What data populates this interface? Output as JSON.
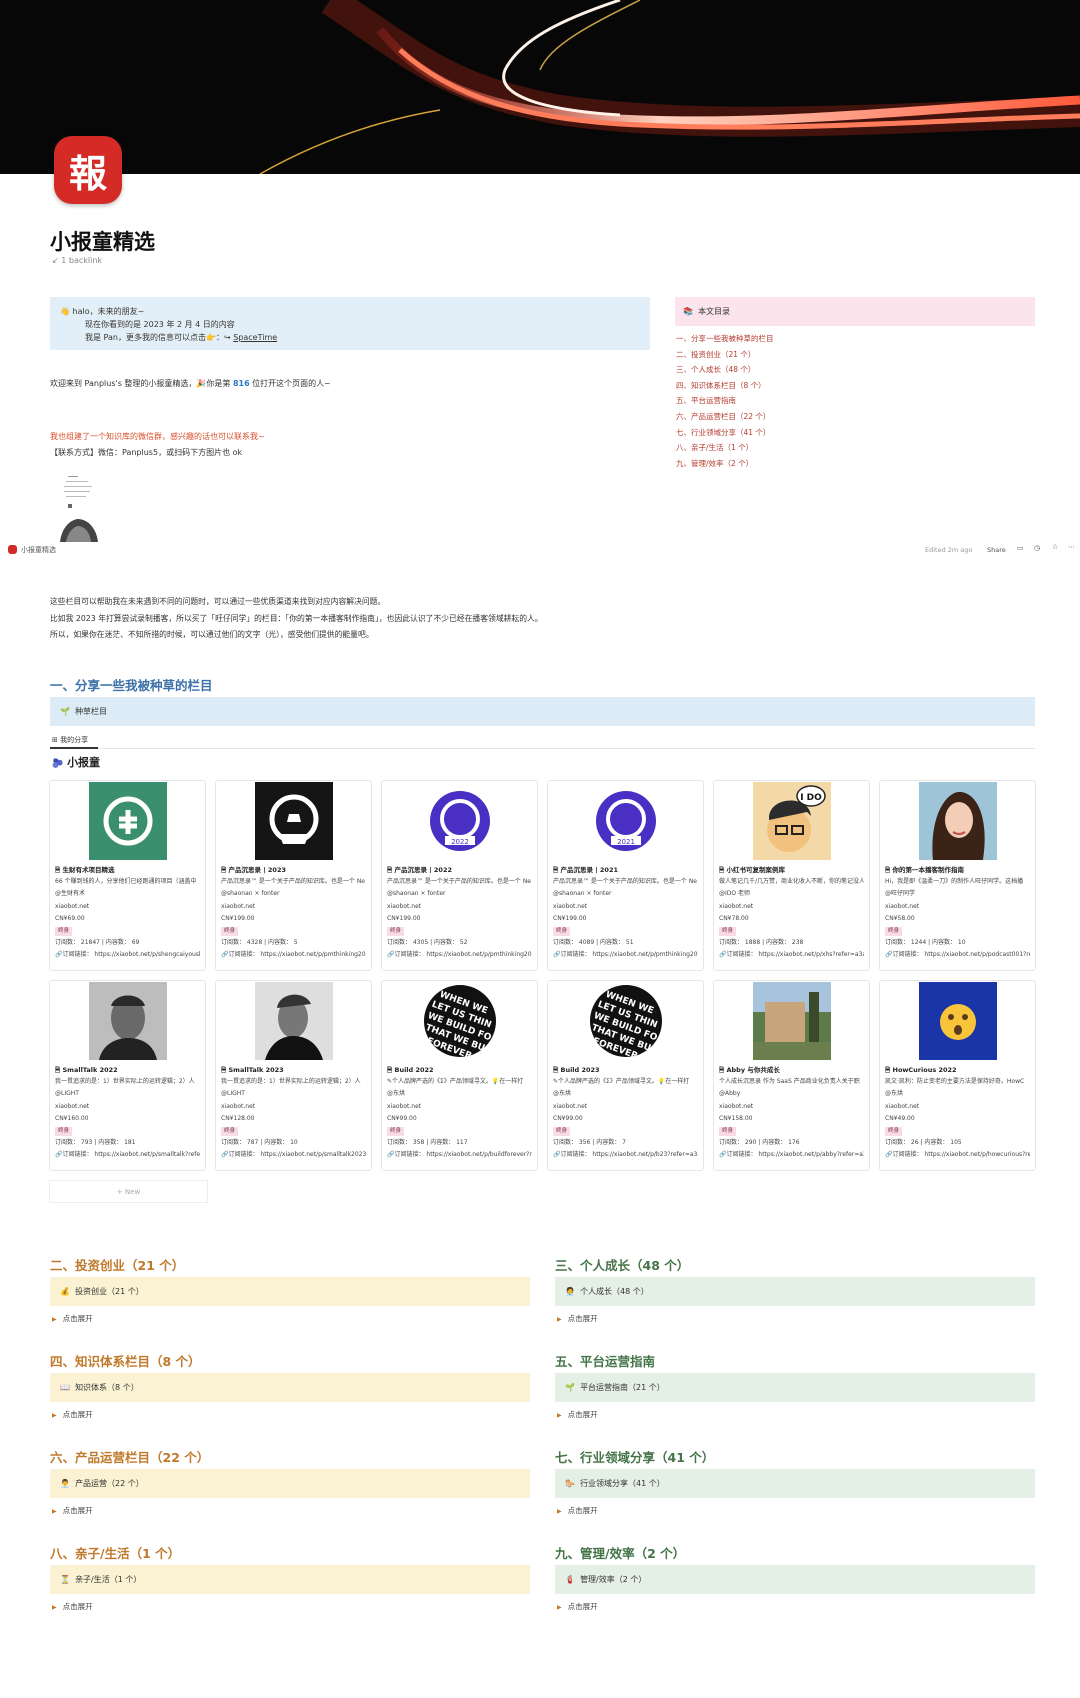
{
  "page": {
    "icon_char": "報",
    "title": "小报童精选",
    "backlink": "↙ 1 backlink"
  },
  "callout": {
    "line1": "halo，未来的朋友~",
    "line2": "现在你看到的是 2023 年 2 月 4 日的内容",
    "line3": "我是 Pan，更多我的信息可以点击",
    "link": "SpaceTime"
  },
  "toc": {
    "title": "本文目录",
    "items": [
      "一、分享一些我被种草的栏目",
      "二、投资创业（21 个）",
      "三、个人成长（48 个）",
      "四、知识体系栏目（8 个）",
      "五、平台运营指南",
      "六、产品运营栏目（22 个）",
      "七、行业领域分享（41 个）",
      "八、亲子/生活（1 个）",
      "九、管理/效率（2 个）"
    ]
  },
  "welcome": {
    "pre": "欢迎来到 Panplus's 整理的小报童精选，🎉你是第 ",
    "count": "816",
    "post": " 位打开这个页面的人~"
  },
  "wechat": {
    "line1": "我也组建了一个知识库的微信群，感兴趣的话也可以联系我~",
    "line2": "【联系方式】微信：Panplus5，或扫码下方图片也 ok"
  },
  "topbar": {
    "breadcrumb": "小报童精选",
    "edited": "Edited 2m ago",
    "share": "Share"
  },
  "intro": [
    "这些栏目可以帮助我在未来遇到不同的问题时，可以通过一些优质渠道来找到对应内容解决问题。",
    "比如我 2023 年打算尝试录制播客，所以买了「旺仔同学」的栏目：「你的第一本播客制作指南」，也因此认识了不少已经在播客领域耕耘的人。",
    "所以，如果你在迷茫、不知所措的时候，可以通过他们的文字（光），感受他们提供的能量吧。"
  ],
  "section1": {
    "heading": "一、分享一些我被种草的栏目",
    "bar": "种草栏目",
    "tab": "我的分享",
    "sub": "小报童"
  },
  "cards": [
    {
      "title": "生财有术项目精选",
      "desc": "66 个赚到钱的人，分享他们已经跑通的项目（涵盖中",
      "author": "@生财有术",
      "site": "xiaobot.net",
      "price": "CN¥69.00",
      "tag": "终身",
      "stats": "订阅数： 21847 | 内容数： 69",
      "link": "订阅链接： https://xiaobot.net/p/shengcaiyoush",
      "bg": "#3a8f6e",
      "icon": "sc"
    },
    {
      "title": "产品沉思录 | 2023",
      "desc": "产品沉思录™ 是一个关于产品的知识库。也是一个 Ne",
      "author": "@shaonan × fonter",
      "site": "xiaobot.net",
      "price": "CN¥199.00",
      "tag": "终身",
      "stats": "订阅数： 4328 | 内容数： 5",
      "link": "订阅链接： https://xiaobot.net/p/pmthinking202",
      "bg": "#151515",
      "icon": "pm"
    },
    {
      "title": "产品沉思录 | 2022",
      "desc": "产品沉思录™ 是一个关于产品的知识库。也是一个 Ne",
      "author": "@shaonan × fonter",
      "site": "xiaobot.net",
      "price": "CN¥199.00",
      "tag": "终身",
      "stats": "订阅数： 4305 | 内容数： 52",
      "link": "订阅链接： https://xiaobot.net/p/pmthinking202",
      "bg": "#fff",
      "icon": "p22"
    },
    {
      "title": "产品沉思录 | 2021",
      "desc": "产品沉思录™ 是一个关于产品的知识库。也是一个 Ne",
      "author": "@shaonan × fonter",
      "site": "xiaobot.net",
      "price": "CN¥199.00",
      "tag": "终身",
      "stats": "订阅数： 4089 | 内容数： 51",
      "link": "订阅链接： https://xiaobot.net/p/pmthinking202",
      "bg": "#fff",
      "icon": "p21"
    },
    {
      "title": "小红书可复制案例库",
      "desc": "做人笔记几千/几万赞，商业化收入不断，你的笔记没人",
      "author": "@IDO 老师",
      "site": "xiaobot.net",
      "price": "CN¥78.00",
      "tag": "终身",
      "stats": "订阅数： 1888 | 内容数： 238",
      "link": "订阅链接： https://xiaobot.net/p/xhs?refer=a3a",
      "bg": "#f3d9a8",
      "icon": "ido"
    },
    {
      "title": "你的第一本播客制作指南",
      "desc": "Hi，我是即《温柔一刀》的制作人旺仔同学。这档播",
      "author": "@旺仔同学",
      "site": "xiaobot.net",
      "price": "CN¥58.00",
      "tag": "终身",
      "stats": "订阅数： 1244 | 内容数： 10",
      "link": "订阅链接： https://xiaobot.net/p/podcast001?re",
      "bg": "#9ec4d8",
      "icon": "girl"
    },
    {
      "title": "SmallTalk 2022",
      "desc": "我一贯追求的是：1）世界实际上的运转逻辑；2）人",
      "author": "@LIGHT",
      "site": "xiaobot.net",
      "price": "CN¥160.00",
      "tag": "终身",
      "stats": "订阅数： 793 | 内容数： 181",
      "link": "订阅链接： https://xiaobot.net/p/smalltalk?refer",
      "bg": "#bdbdbd",
      "icon": "man1"
    },
    {
      "title": "SmallTalk 2023",
      "desc": "我一贯追求的是：1）世界实际上的运转逻辑；2）人",
      "author": "@LIGHT",
      "site": "xiaobot.net",
      "price": "CN¥128.00",
      "tag": "终身",
      "stats": "订阅数： 787 | 内容数： 10",
      "link": "订阅链接： https://xiaobot.net/p/smalltalk2023?",
      "bg": "#cfcfcf",
      "icon": "man2"
    },
    {
      "title": "Build 2022",
      "desc": "✎个人品牌严选的《Σ》产品领域寻文。💡在一样打",
      "author": "@东烘",
      "site": "xiaobot.net",
      "price": "CN¥99.00",
      "tag": "终身",
      "stats": "订阅数： 358 | 内容数： 117",
      "link": "订阅链接： https://xiaobot.net/p/buildforever?r",
      "bg": "#fff",
      "icon": "build"
    },
    {
      "title": "Build 2023",
      "desc": "✎个人品牌严选的《Σ》产品领域寻文。💡在一样打",
      "author": "@东烘",
      "site": "xiaobot.net",
      "price": "CN¥99.00",
      "tag": "终身",
      "stats": "订阅数： 356 | 内容数： 7",
      "link": "订阅链接： https://xiaobot.net/p/b23?refer=a3a",
      "bg": "#fff",
      "icon": "build"
    },
    {
      "title": "Abby 与你共成长",
      "desc": "个人成长沉思录 作为 SaaS 产品商业化负责人关于职",
      "author": "@Abby",
      "site": "xiaobot.net",
      "price": "CN¥158.00",
      "tag": "终身",
      "stats": "订阅数： 290 | 内容数： 176",
      "link": "订阅链接： https://xiaobot.net/p/abby?refer=a3a",
      "bg": "#8a9a6a",
      "icon": "abby"
    },
    {
      "title": "HowCurious 2022",
      "desc": "凯文·凯利：防止变老的主要方法是保持好奇。HowC",
      "author": "@东烘",
      "site": "xiaobot.net",
      "price": "CN¥49.00",
      "tag": "终身",
      "stats": "订阅数： 26 | 内容数： 105",
      "link": "订阅链接： https://xiaobot.net/p/howcurious?re",
      "bg": "#1a35a8",
      "icon": "wow"
    }
  ],
  "new_label": "+ New",
  "sections": [
    {
      "heading": "二、投资创业（21 个）",
      "bar": "投资创业（21 个）",
      "emoji": "💰",
      "color": "yel",
      "toggle": "点击展开"
    },
    {
      "heading": "三、个人成长（48 个）",
      "bar": "个人成长（48 个）",
      "emoji": "🧑‍💼",
      "color": "grn",
      "toggle": "点击展开"
    },
    {
      "heading": "四、知识体系栏目（8 个）",
      "bar": "知识体系（8 个）",
      "emoji": "📖",
      "color": "yel",
      "toggle": "点击展开"
    },
    {
      "heading": "五、平台运营指南",
      "bar": "平台运营指南（21 个）",
      "emoji": "🌱",
      "color": "grn",
      "toggle": "点击展开"
    },
    {
      "heading": "六、产品运营栏目（22 个）",
      "bar": "产品运营（22 个）",
      "emoji": "👨‍💼",
      "color": "yel",
      "toggle": "点击展开"
    },
    {
      "heading": "七、行业领域分享（41 个）",
      "bar": "行业领域分享（41 个）",
      "emoji": "🐎",
      "color": "grn",
      "toggle": "点击展开"
    },
    {
      "heading": "八、亲子/生活（1 个）",
      "bar": "亲子/生活（1 个）",
      "emoji": "⏳",
      "color": "yel",
      "toggle": "点击展开"
    },
    {
      "heading": "九、管理/效率（2 个）",
      "bar": "管理/效率（2 个）",
      "emoji": "🧯",
      "color": "grn",
      "toggle": "点击展开"
    }
  ],
  "colors": {
    "toc_bg": "#fbe4ec",
    "callout_bg": "#e3eff8",
    "heading_blue": "#3b70a8",
    "heading_green": "#447448",
    "heading_orange": "#c0792a"
  }
}
